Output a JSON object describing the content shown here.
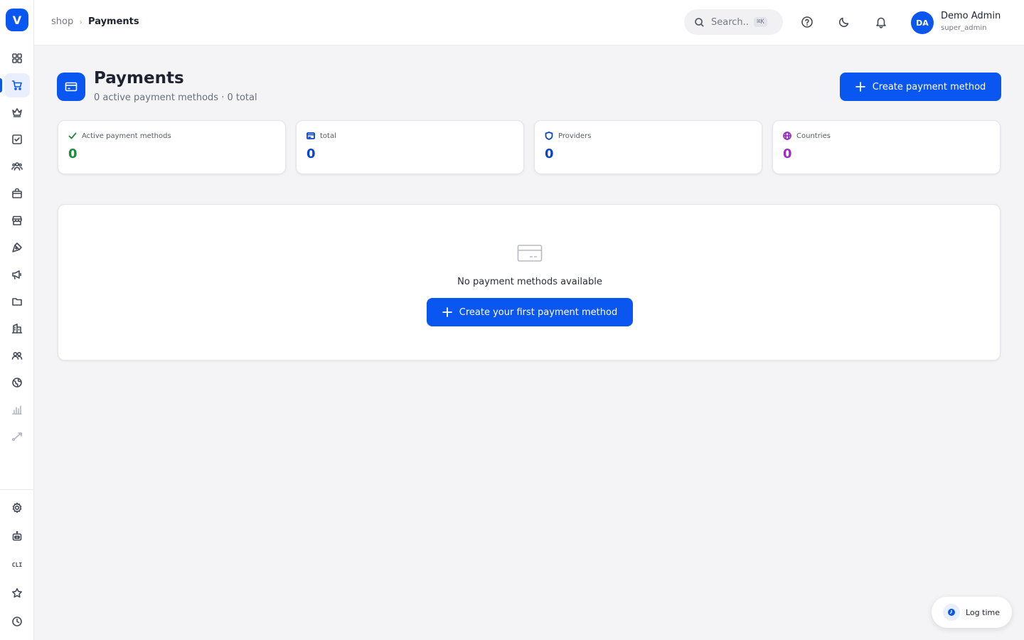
{
  "app": {
    "logo_letter": "V"
  },
  "breadcrumb": {
    "parent": "shop",
    "current": "Payments"
  },
  "search": {
    "placeholder": "Search...",
    "shortcut": "⌘K"
  },
  "user": {
    "initials": "DA",
    "name": "Demo Admin",
    "role": "super_admin"
  },
  "page": {
    "title": "Payments",
    "subtitle": "0 active payment methods · 0 total",
    "create_button": "Create payment method"
  },
  "stats": [
    {
      "label": "Active payment methods",
      "value": "0",
      "color": "#1b8a3a",
      "icon": "check-icon"
    },
    {
      "label": "total",
      "value": "0",
      "color": "#0b46c4",
      "icon": "credit-card-icon"
    },
    {
      "label": "Providers",
      "value": "0",
      "color": "#0b46c4",
      "icon": "shield-icon"
    },
    {
      "label": "Countries",
      "value": "0",
      "color": "#9b2fc0",
      "icon": "globe-icon"
    }
  ],
  "empty_state": {
    "message": "No payment methods available",
    "button": "Create your first payment method"
  },
  "sidebar": {
    "cli_label": "CLI",
    "items": [
      "dashboard-icon",
      "cart-icon",
      "crown-icon",
      "checkbox-icon",
      "team-icon",
      "shopping-bag-icon",
      "store-icon",
      "pen-tool-icon",
      "megaphone-icon",
      "folder-icon",
      "building-icon",
      "users-icon",
      "globe-icon",
      "bar-chart-icon",
      "route-icon"
    ],
    "bottom_items": [
      "settings-icon",
      "robot-icon",
      "cli-icon",
      "star-icon",
      "clock-icon"
    ]
  },
  "log_time": {
    "label": "Log time"
  },
  "colors": {
    "accent": "#0a56f0",
    "background": "#f4f4f6"
  }
}
